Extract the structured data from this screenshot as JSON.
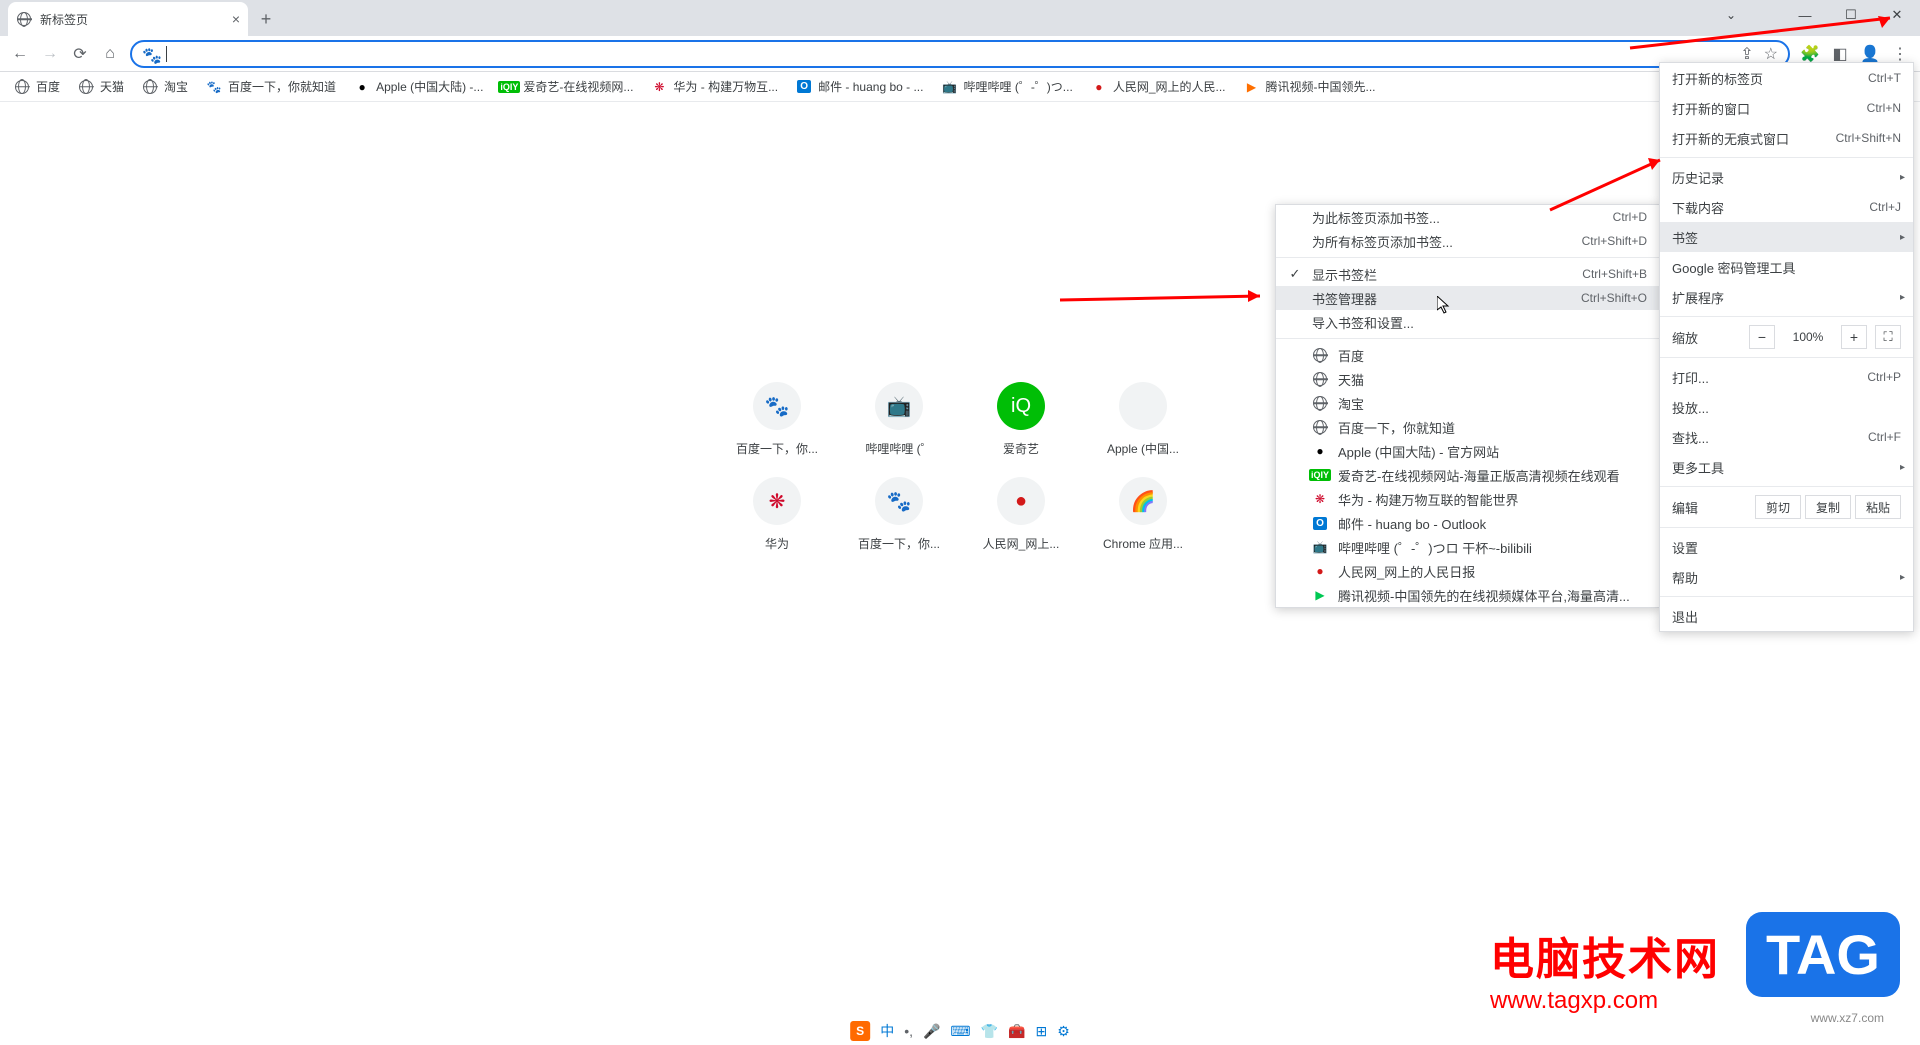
{
  "tab": {
    "title": "新标签页"
  },
  "bookmarks": [
    {
      "label": "百度",
      "icon": "globe",
      "color": "#5f6368"
    },
    {
      "label": "天猫",
      "icon": "globe",
      "color": "#5f6368"
    },
    {
      "label": "淘宝",
      "icon": "globe",
      "color": "#5f6368"
    },
    {
      "label": "百度一下，你就知道",
      "icon": "baidu",
      "color": "#2932e1"
    },
    {
      "label": "Apple (中国大陆) -...",
      "icon": "apple",
      "color": "#000"
    },
    {
      "label": "爱奇艺-在线视频网...",
      "icon": "iqiyi",
      "color": "#00be06"
    },
    {
      "label": "华为 - 构建万物互...",
      "icon": "huawei",
      "color": "#cf0a2c"
    },
    {
      "label": "邮件 - huang bo - ...",
      "icon": "outlook",
      "color": "#0078d4"
    },
    {
      "label": "哔哩哔哩 (゜-゜)つ...",
      "icon": "bili",
      "color": "#00a1d6"
    },
    {
      "label": "人民网_网上的人民...",
      "icon": "people",
      "color": "#d31919"
    },
    {
      "label": "腾讯视频-中国领先...",
      "icon": "tencent",
      "color": "#ff6f00"
    }
  ],
  "shortcuts": [
    {
      "label": "百度一下，你...",
      "icon": "🐾",
      "bg": "#f1f3f4",
      "color": "#2932e1"
    },
    {
      "label": "哔哩哔哩 (゜",
      "icon": "📺",
      "bg": "#f1f3f4",
      "color": "#00a1d6"
    },
    {
      "label": "爱奇艺",
      "icon": "iQ",
      "bg": "#00be06",
      "color": "#fff"
    },
    {
      "label": "Apple (中国...",
      "icon": "",
      "bg": "#f1f3f4",
      "color": "#000"
    },
    {
      "label": "华为",
      "icon": "❋",
      "bg": "#f1f3f4",
      "color": "#cf0a2c"
    },
    {
      "label": "百度一下，你...",
      "icon": "🐾",
      "bg": "#f1f3f4",
      "color": "#2932e1"
    },
    {
      "label": "人民网_网上...",
      "icon": "●",
      "bg": "#f1f3f4",
      "color": "#d31919"
    },
    {
      "label": "Chrome 应用...",
      "icon": "🌈",
      "bg": "#f1f3f4",
      "color": "#5f6368"
    }
  ],
  "mainMenu": {
    "newTab": {
      "label": "打开新的标签页",
      "shortcut": "Ctrl+T"
    },
    "newWindow": {
      "label": "打开新的窗口",
      "shortcut": "Ctrl+N"
    },
    "newIncognito": {
      "label": "打开新的无痕式窗口",
      "shortcut": "Ctrl+Shift+N"
    },
    "history": {
      "label": "历史记录"
    },
    "downloads": {
      "label": "下载内容",
      "shortcut": "Ctrl+J"
    },
    "bookmarks": {
      "label": "书签"
    },
    "passwords": {
      "label": "Google 密码管理工具"
    },
    "extensions": {
      "label": "扩展程序"
    },
    "zoom": {
      "label": "缩放",
      "value": "100%"
    },
    "print": {
      "label": "打印...",
      "shortcut": "Ctrl+P"
    },
    "cast": {
      "label": "投放..."
    },
    "find": {
      "label": "查找...",
      "shortcut": "Ctrl+F"
    },
    "moreTools": {
      "label": "更多工具"
    },
    "edit": {
      "label": "编辑",
      "cut": "剪切",
      "copy": "复制",
      "paste": "粘贴"
    },
    "settings": {
      "label": "设置"
    },
    "help": {
      "label": "帮助"
    },
    "exit": {
      "label": "退出"
    }
  },
  "subMenu": {
    "addBookmark": {
      "label": "为此标签页添加书签...",
      "shortcut": "Ctrl+D"
    },
    "addAllBookmarks": {
      "label": "为所有标签页添加书签...",
      "shortcut": "Ctrl+Shift+D"
    },
    "showBar": {
      "label": "显示书签栏",
      "shortcut": "Ctrl+Shift+B"
    },
    "manager": {
      "label": "书签管理器",
      "shortcut": "Ctrl+Shift+O"
    },
    "import": {
      "label": "导入书签和设置..."
    },
    "items": [
      {
        "label": "百度",
        "icon": "globe"
      },
      {
        "label": "天猫",
        "icon": "globe"
      },
      {
        "label": "淘宝",
        "icon": "globe"
      },
      {
        "label": "百度一下，你就知道",
        "icon": "globe"
      },
      {
        "label": "Apple (中国大陆) - 官方网站",
        "icon": "apple"
      },
      {
        "label": "爱奇艺-在线视频网站-海量正版高清视频在线观看",
        "icon": "iqiyi"
      },
      {
        "label": "华为 - 构建万物互联的智能世界",
        "icon": "huawei"
      },
      {
        "label": "邮件 - huang bo - Outlook",
        "icon": "outlook"
      },
      {
        "label": "哔哩哔哩 (゜-゜)つロ 干杯~-bilibili",
        "icon": "bili"
      },
      {
        "label": "人民网_网上的人民日报",
        "icon": "people"
      },
      {
        "label": "腾讯视频-中国领先的在线视频媒体平台,海量高清...",
        "icon": "tencent"
      }
    ]
  },
  "ime": {
    "label": "中"
  },
  "watermark": {
    "t1": "电脑技术网",
    "t2": "www.tagxp.com",
    "tag": "TAG"
  },
  "wm2": "www.xz7.com"
}
